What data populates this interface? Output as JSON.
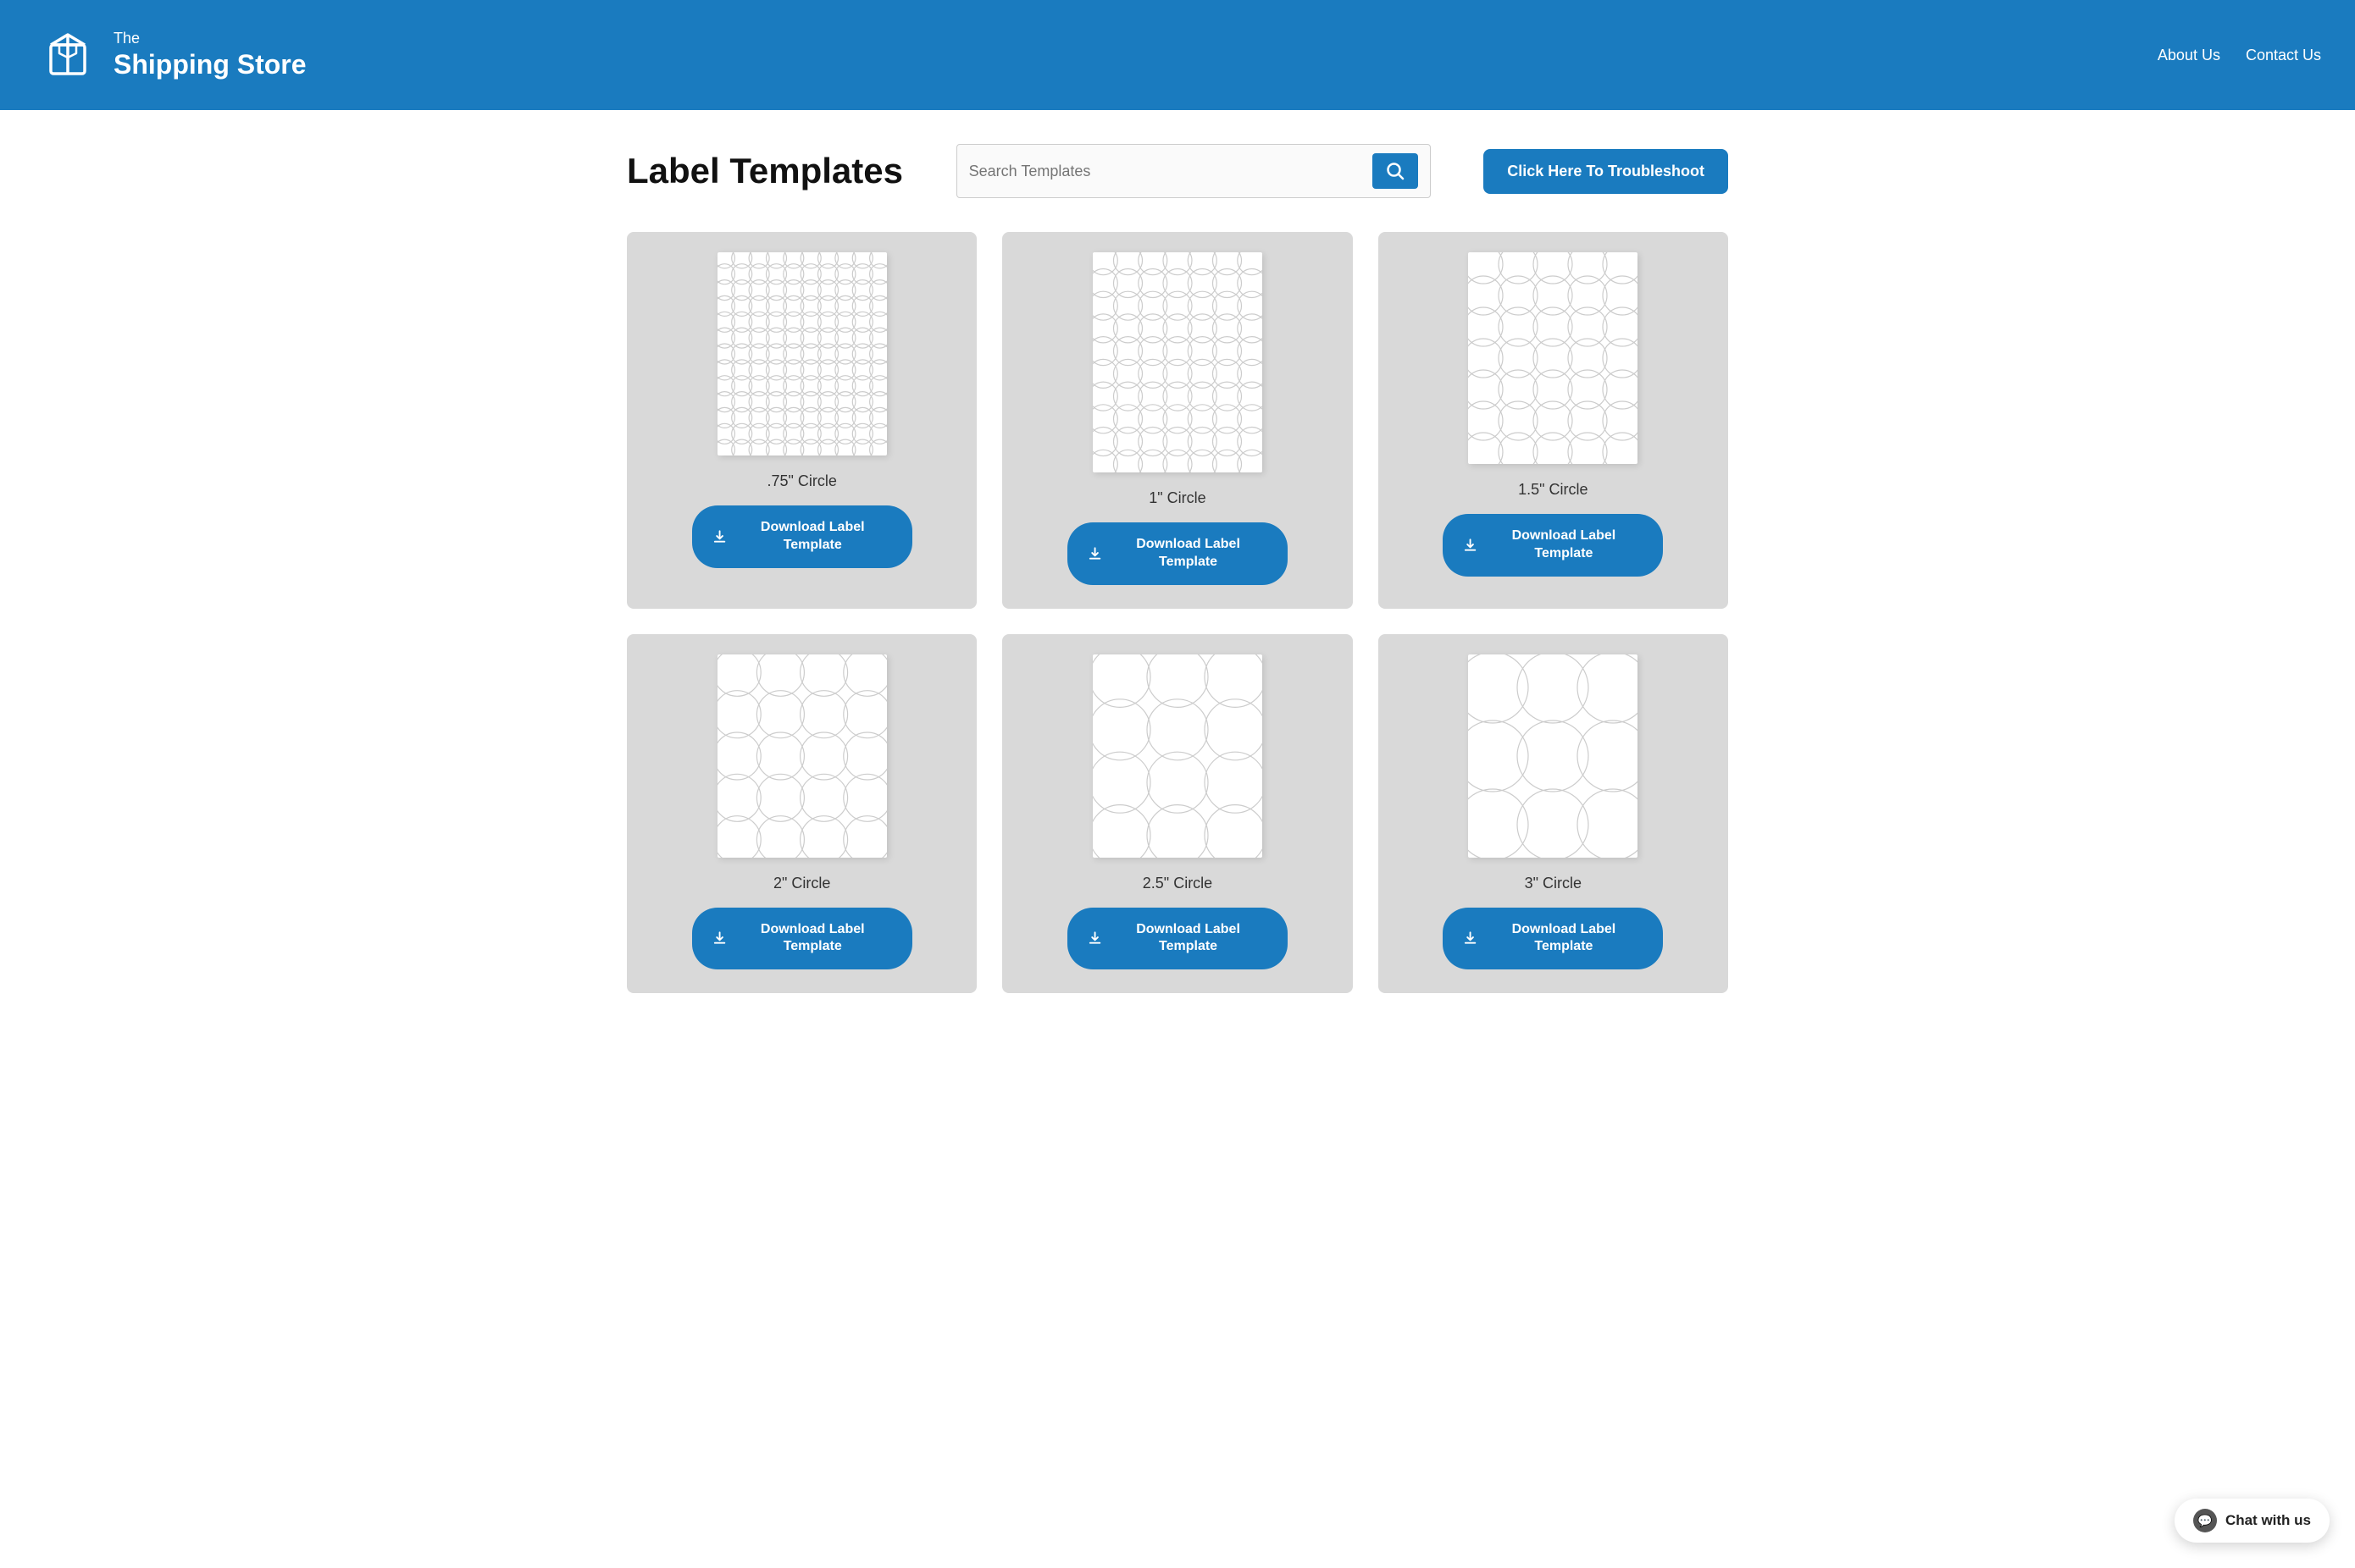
{
  "header": {
    "logo_line1": "The",
    "logo_line2": "Shipping Store",
    "nav": {
      "about": "About Us",
      "contact": "Contact Us"
    }
  },
  "main": {
    "page_title": "Label Templates",
    "search": {
      "placeholder": "Search Templates"
    },
    "troubleshoot_btn": "Click Here To Troubleshoot",
    "download_btn_label": "Download Label Template",
    "templates": [
      {
        "name": ".75\" Circle",
        "cols": 10,
        "rows": 13,
        "radius": 12,
        "preview_w": 200,
        "preview_h": 240
      },
      {
        "name": "1\" Circle",
        "cols": 7,
        "rows": 10,
        "radius": 17,
        "preview_w": 200,
        "preview_h": 260
      },
      {
        "name": "1.5\" Circle",
        "cols": 5,
        "rows": 7,
        "radius": 23,
        "preview_w": 200,
        "preview_h": 250
      },
      {
        "name": "2\" Circle",
        "cols": 4,
        "rows": 5,
        "radius": 28,
        "preview_w": 200,
        "preview_h": 240
      },
      {
        "name": "2.5\" Circle",
        "cols": 3,
        "rows": 4,
        "radius": 36,
        "preview_w": 200,
        "preview_h": 240
      },
      {
        "name": "3\" Circle",
        "cols": 3,
        "rows": 3,
        "radius": 42,
        "preview_w": 200,
        "preview_h": 240
      }
    ]
  },
  "chat": {
    "label": "Chat with us"
  }
}
